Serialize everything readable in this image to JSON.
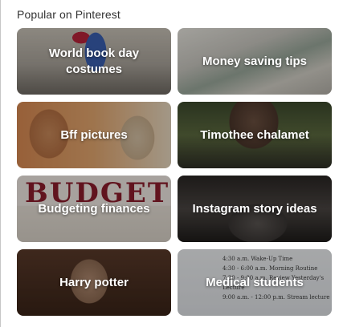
{
  "section": {
    "heading": "Popular on Pinterest"
  },
  "tiles": [
    {
      "label": "World book day costumes"
    },
    {
      "label": "Money saving tips"
    },
    {
      "label": "Bff pictures"
    },
    {
      "label": "Timothee chalamet"
    },
    {
      "label": "Budgeting finances"
    },
    {
      "label": "Instagram story ideas"
    },
    {
      "label": "Harry potter"
    },
    {
      "label": "Medical students"
    }
  ],
  "decor": {
    "budget_word": "BUDGET",
    "schedule_lines": [
      "4:30 a.m.   Wake-Up Time",
      "4:30 - 6:00 a.m.   Morning Routine",
      "7:30 - 9:00 a.m.   Review Yesterday's Lecture",
      "9:00 a.m. - 12:00 p.m.   Stream lecture"
    ]
  }
}
